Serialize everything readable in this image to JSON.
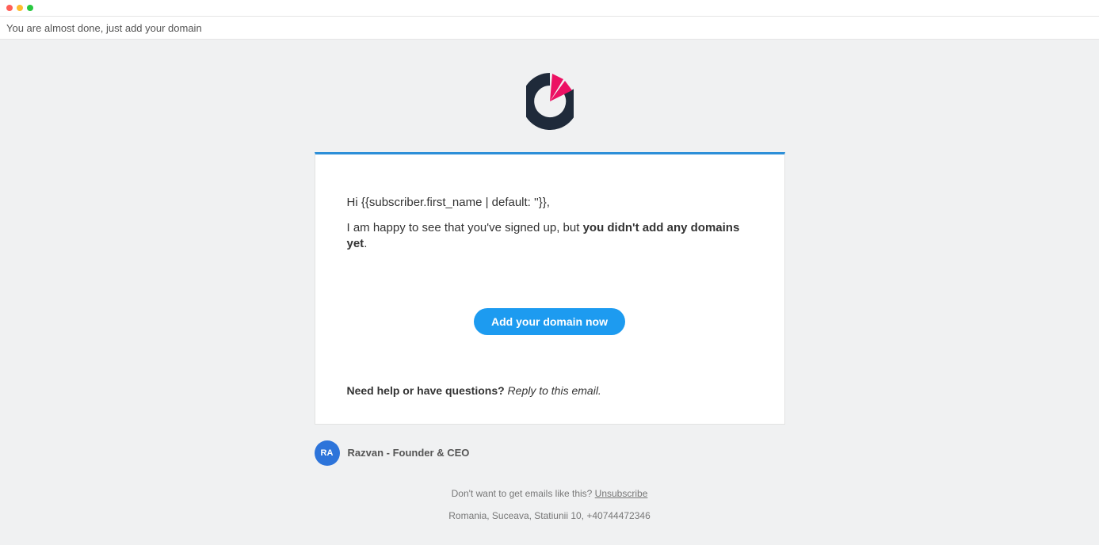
{
  "window": {
    "subject": "You are almost done, just add your domain"
  },
  "email": {
    "greeting": "Hi {{subscriber.first_name | default: ''}},",
    "intro_part1": "I am happy to see that you've signed up, but ",
    "intro_bold": "you didn't add any domains yet",
    "intro_part2": ".",
    "cta_label": "Add your domain now",
    "help_question": "Need help or have questions?",
    "help_answer": " Reply to this email."
  },
  "sender": {
    "avatar_initials": "RA",
    "name": "Razvan",
    "separator": " - ",
    "role": "Founder & CEO"
  },
  "footer": {
    "unsub_prefix": "Don't want to get emails like this? ",
    "unsub_label": "Unsubscribe",
    "address": "Romania, Suceava, Statiunii 10, +40744472346"
  }
}
